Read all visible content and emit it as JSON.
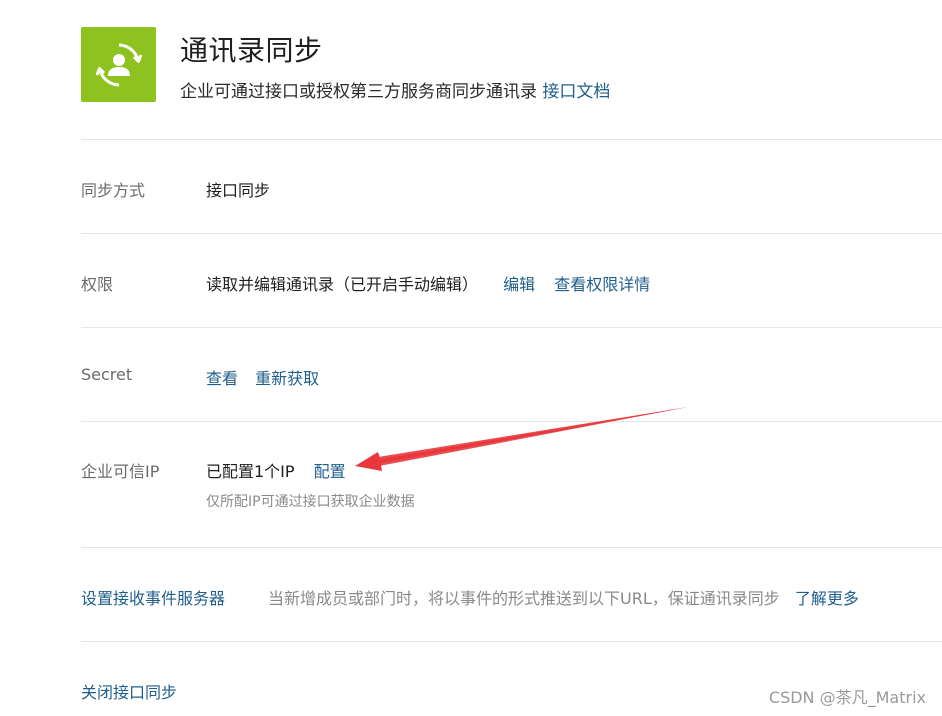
{
  "header": {
    "icon": "contacts-sync-icon",
    "icon_color": "#8dc21f",
    "title": "通讯录同步",
    "subtitle": "企业可通过接口或授权第三方服务商同步通讯录",
    "doc_link": "接口文档"
  },
  "rows": {
    "sync_mode": {
      "label": "同步方式",
      "value": "接口同步"
    },
    "permission": {
      "label": "权限",
      "value": "读取并编辑通讯录（已开启手动编辑）",
      "edit_link": "编辑",
      "details_link": "查看权限详情"
    },
    "secret": {
      "label": "Secret",
      "view_link": "查看",
      "refresh_link": "重新获取"
    },
    "trusted_ip": {
      "label": "企业可信IP",
      "value": "已配置1个IP",
      "config_link": "配置",
      "hint": "仅所配IP可通过接口获取企业数据"
    },
    "event_server": {
      "link": "设置接收事件服务器",
      "description": "当新增成员或部门时，将以事件的形式推送到以下URL，保证通讯录同步",
      "learn_more_link": "了解更多"
    },
    "close_sync": {
      "link": "关闭接口同步"
    }
  },
  "colors": {
    "link": "#1e5f8e",
    "annotation_arrow": "#e8383d"
  },
  "watermark": "CSDN @茶凡_Matrix"
}
